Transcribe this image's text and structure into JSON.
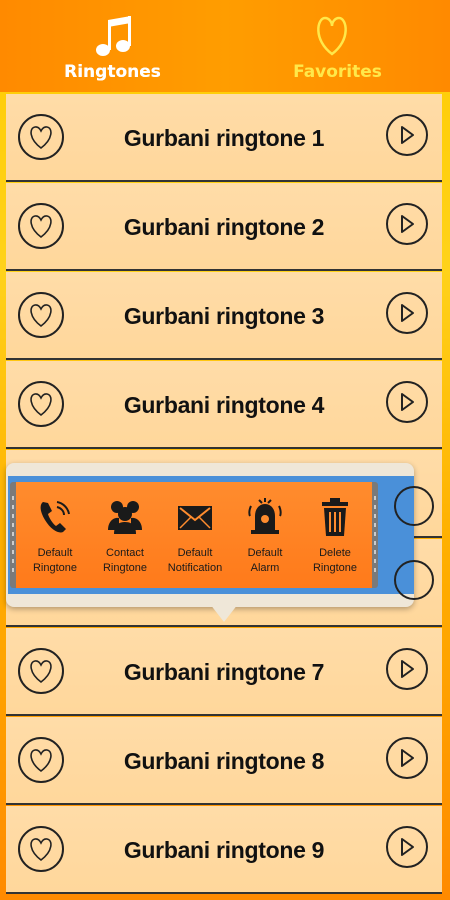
{
  "tabs": [
    {
      "label": "Ringtones",
      "icon": "music-note-icon",
      "active": true
    },
    {
      "label": "Favorites",
      "icon": "heart-icon",
      "active": false
    }
  ],
  "rows": [
    {
      "title": "Gurbani ringtone  1"
    },
    {
      "title": "Gurbani ringtone  2"
    },
    {
      "title": "Gurbani ringtone  3"
    },
    {
      "title": "Gurbani ringtone  4"
    },
    {
      "title": "Gurbani ringtone  7"
    },
    {
      "title": "Gurbani ringtone  8"
    },
    {
      "title": "Gurbani ringtone  9"
    }
  ],
  "popup": {
    "actions": [
      {
        "line1": "Default",
        "line2": "Ringtone",
        "icon": "phone-icon"
      },
      {
        "line1": "Contact",
        "line2": "Ringtone",
        "icon": "contact-group-icon"
      },
      {
        "line1": "Default",
        "line2": "Notification",
        "icon": "envelope-icon"
      },
      {
        "line1": "Default",
        "line2": "Alarm",
        "icon": "alarm-bell-icon"
      },
      {
        "line1": "Delete",
        "line2": "Ringtone",
        "icon": "trash-icon"
      }
    ]
  },
  "colors": {
    "tabbar": "#ff8a00",
    "row_bg": "#ffdca8",
    "popup_panel": "#ff7a1a",
    "popup_backdrop": "#4a90d9"
  }
}
